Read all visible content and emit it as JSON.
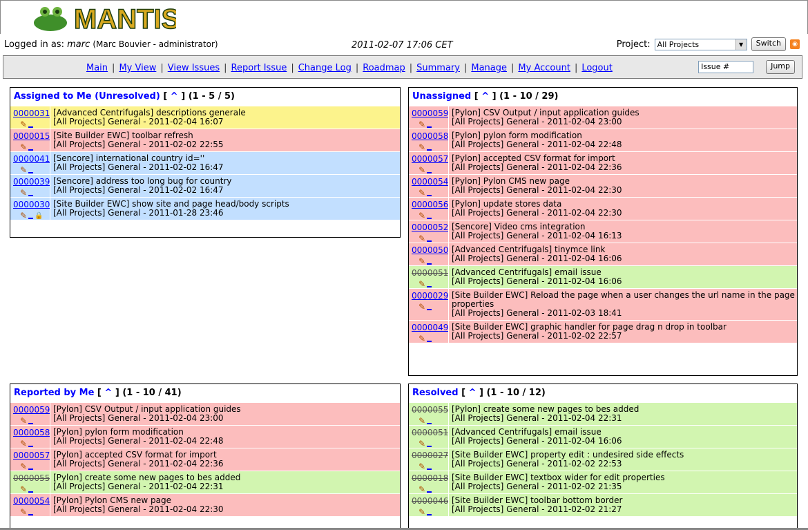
{
  "header": {
    "logo_text": "MANTIS",
    "logged_in_label": "Logged in as:",
    "username": "marc",
    "user_detail": "(Marc Bouvier - administrator)",
    "datetime": "2011-02-07 17:06 CET",
    "project_label": "Project:",
    "project_value": "All Projects",
    "switch_label": "Switch",
    "rss_icon": "rss-icon"
  },
  "nav": {
    "links": [
      "Main",
      "My View",
      "View Issues",
      "Report Issue",
      "Change Log",
      "Roadmap",
      "Summary",
      "Manage",
      "My Account",
      "Logout"
    ],
    "issue_placeholder": "Issue #",
    "jump_label": "Jump"
  },
  "colors": {
    "yellow": "#fcf38c",
    "pink": "#fcbdbd",
    "blue": "#c2dfff",
    "green": "#d2f5b0"
  },
  "panels": [
    {
      "key": "assigned",
      "title": "Assigned to Me (Unresolved)",
      "caret": "^",
      "range": "(1 - 5 / 5)",
      "rows": [
        {
          "id": "0000031",
          "color": "yellow",
          "summary": "[Advanced Centrifugals] descriptions generale",
          "meta": "[All Projects] General - 2011-02-04 16:07"
        },
        {
          "id": "0000015",
          "color": "pink",
          "summary": "[Site Builder EWC] toolbar refresh",
          "meta": "[All Projects] General - 2011-02-02 22:55"
        },
        {
          "id": "0000041",
          "color": "blue",
          "summary": "[Sencore] international country id=''",
          "meta": "[All Projects] General - 2011-02-02 16:47"
        },
        {
          "id": "0000039",
          "color": "blue",
          "summary": "[Sencore] address too long bug for country",
          "meta": "[All Projects] General - 2011-02-02 16:47"
        },
        {
          "id": "0000030",
          "color": "blue",
          "summary": "[Site Builder EWC] show site and page head/body scripts",
          "meta": "[All Projects] General - 2011-01-28 23:46",
          "lock": true
        }
      ]
    },
    {
      "key": "unassigned",
      "title": "Unassigned",
      "caret": "^",
      "range": "(1 - 10 / 29)",
      "rows": [
        {
          "id": "0000059",
          "color": "pink",
          "summary": "[Pylon] CSV Output / input application guides",
          "meta": "[All Projects] General - 2011-02-04 23:00"
        },
        {
          "id": "0000058",
          "color": "pink",
          "summary": "[Pylon] pylon form modification",
          "meta": "[All Projects] General - 2011-02-04 22:48"
        },
        {
          "id": "0000057",
          "color": "pink",
          "summary": "[Pylon] accepted CSV format for import",
          "meta": "[All Projects] General - 2011-02-04 22:36"
        },
        {
          "id": "0000054",
          "color": "pink",
          "summary": "[Pylon] Pylon CMS new page",
          "meta": "[All Projects] General - 2011-02-04 22:30"
        },
        {
          "id": "0000056",
          "color": "pink",
          "summary": "[Pylon] update stores data",
          "meta": "[All Projects] General - 2011-02-04 22:30"
        },
        {
          "id": "0000052",
          "color": "pink",
          "summary": "[Sencore] Video cms integration",
          "meta": "[All Projects] General - 2011-02-04 16:13"
        },
        {
          "id": "0000050",
          "color": "pink",
          "summary": "[Advanced Centrifugals] tinymce link",
          "meta": "[All Projects] General - 2011-02-04 16:06"
        },
        {
          "id": "0000051",
          "color": "green",
          "resolved": true,
          "summary": "[Advanced Centrifugals] email issue",
          "meta": "[All Projects] General - 2011-02-04 16:06"
        },
        {
          "id": "0000029",
          "color": "pink",
          "summary": "[Site Builder EWC] Reload the page when a user changes the url name in the page properties",
          "meta": "[All Projects] General - 2011-02-03 18:41"
        },
        {
          "id": "0000049",
          "color": "pink",
          "summary": "[Site Builder EWC] graphic handler for page drag n drop in toolbar",
          "meta": "[All Projects] General - 2011-02-02 22:57"
        }
      ]
    },
    {
      "key": "reported",
      "title": "Reported by Me",
      "caret": "^",
      "range": "(1 - 10 / 41)",
      "rows": [
        {
          "id": "0000059",
          "color": "pink",
          "summary": "[Pylon] CSV Output / input application guides",
          "meta": "[All Projects] General - 2011-02-04 23:00"
        },
        {
          "id": "0000058",
          "color": "pink",
          "summary": "[Pylon] pylon form modification",
          "meta": "[All Projects] General - 2011-02-04 22:48"
        },
        {
          "id": "0000057",
          "color": "pink",
          "summary": "[Pylon] accepted CSV format for import",
          "meta": "[All Projects] General - 2011-02-04 22:36"
        },
        {
          "id": "0000055",
          "color": "green",
          "resolved": true,
          "summary": "[Pylon] create some new pages to bes added",
          "meta": "[All Projects] General - 2011-02-04 22:31"
        },
        {
          "id": "0000054",
          "color": "pink",
          "summary": "[Pylon] Pylon CMS new page",
          "meta": "[All Projects] General - 2011-02-04 22:30"
        }
      ]
    },
    {
      "key": "resolved",
      "title": "Resolved",
      "caret": "^",
      "range": "(1 - 10 / 12)",
      "rows": [
        {
          "id": "0000055",
          "color": "green",
          "resolved": true,
          "summary": "[Pylon] create some new pages to bes added",
          "meta": "[All Projects] General - 2011-02-04 22:31"
        },
        {
          "id": "0000051",
          "color": "green",
          "resolved": true,
          "summary": "[Advanced Centrifugals] email issue",
          "meta": "[All Projects] General - 2011-02-04 16:06"
        },
        {
          "id": "0000027",
          "color": "green",
          "resolved": true,
          "summary": "[Site Builder EWC] property edit : undesired side effects",
          "meta": "[All Projects] General - 2011-02-02 22:53"
        },
        {
          "id": "0000018",
          "color": "green",
          "resolved": true,
          "summary": "[Site Builder EWC] textbox wider for edit properties",
          "meta": "[All Projects] General - 2011-02-02 21:35"
        },
        {
          "id": "0000046",
          "color": "green",
          "resolved": true,
          "summary": "[Site Builder EWC] toolbar bottom border",
          "meta": "[All Projects] General - 2011-02-02 21:27"
        }
      ]
    }
  ]
}
